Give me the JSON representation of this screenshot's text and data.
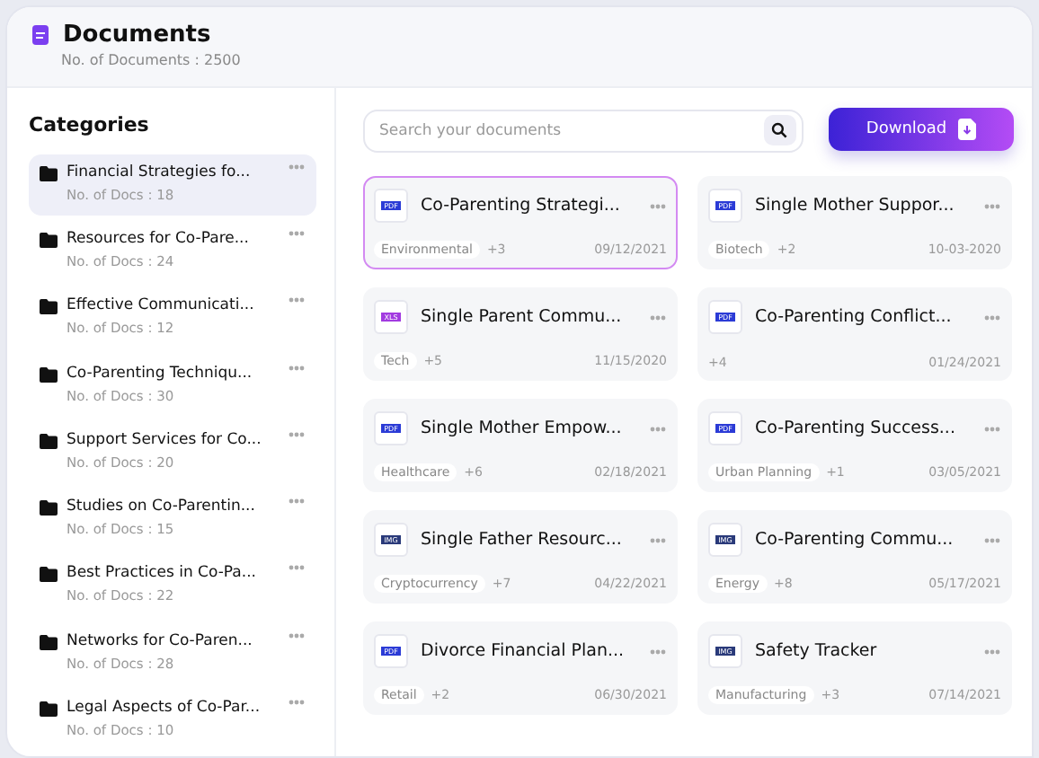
{
  "header": {
    "title": "Documents",
    "subtitle": "No. of Documents : 2500"
  },
  "sidebar": {
    "title": "Categories",
    "items": [
      {
        "name": "Financial Strategies fo...",
        "count": "No. of Docs : 18",
        "selected": true
      },
      {
        "name": "Resources for Co-Pare...",
        "count": "No. of Docs : 24",
        "selected": false
      },
      {
        "name": "Effective Communicati...",
        "count": "No. of Docs : 12",
        "selected": false
      },
      {
        "name": "Co-Parenting Techniqu...",
        "count": "No. of Docs : 30",
        "selected": false
      },
      {
        "name": "Support Services for Co...",
        "count": "No. of Docs : 20",
        "selected": false
      },
      {
        "name": "Studies on Co-Parentin...",
        "count": "No. of Docs : 15",
        "selected": false
      },
      {
        "name": "Best Practices in Co-Pa...",
        "count": "No. of Docs : 22",
        "selected": false
      },
      {
        "name": "Networks for Co-Paren...",
        "count": "No. of Docs : 28",
        "selected": false
      },
      {
        "name": "Legal Aspects of Co-Par...",
        "count": "No. of Docs : 10",
        "selected": false
      }
    ]
  },
  "search": {
    "placeholder": "Search your documents"
  },
  "download_button": {
    "label": "Download"
  },
  "documents": [
    {
      "title": "Co-Parenting Strategi...",
      "kind": "pdf",
      "file_type": "PDF",
      "tag": "Environmental",
      "more": "+3",
      "date": "09/12/2021",
      "selected": true
    },
    {
      "title": "Single Mother Suppor...",
      "kind": "pdf",
      "file_type": "PDF",
      "tag": "Biotech",
      "more": "+2",
      "date": "10-03-2020",
      "selected": false
    },
    {
      "title": "Single Parent Commu...",
      "kind": "xls",
      "file_type": "XLS",
      "tag": "Tech",
      "more": "+5",
      "date": "11/15/2020",
      "selected": false
    },
    {
      "title": "Co-Parenting Conflict...",
      "kind": "pdf",
      "file_type": "PDF",
      "more": "+4",
      "date": "01/24/2021",
      "selected": false
    },
    {
      "title": "Single Mother Empow...",
      "kind": "pdf",
      "file_type": "PDF",
      "tag": "Healthcare",
      "more": "+6",
      "date": "02/18/2021",
      "selected": false
    },
    {
      "title": "Co-Parenting Success...",
      "kind": "pdf",
      "file_type": "PDF",
      "tag": "Urban Planning",
      "more": "+1",
      "date": "03/05/2021",
      "selected": false
    },
    {
      "title": "Single Father Resourc...",
      "kind": "img",
      "file_type": "IMG",
      "tag": "Cryptocurrency",
      "more": "+7",
      "date": "04/22/2021",
      "selected": false
    },
    {
      "title": "Co-Parenting Commu...",
      "kind": "img",
      "file_type": "IMG",
      "tag": "Energy",
      "more": "+8",
      "date": "05/17/2021",
      "selected": false
    },
    {
      "title": "Divorce Financial Plan...",
      "kind": "pdf",
      "file_type": "PDF",
      "tag": "Retail",
      "more": "+2",
      "date": "06/30/2021",
      "selected": false
    },
    {
      "title": "Safety Tracker",
      "kind": "img",
      "file_type": "IMG",
      "tag": "Manufacturing",
      "more": "+3",
      "date": "07/14/2021",
      "selected": false
    }
  ]
}
